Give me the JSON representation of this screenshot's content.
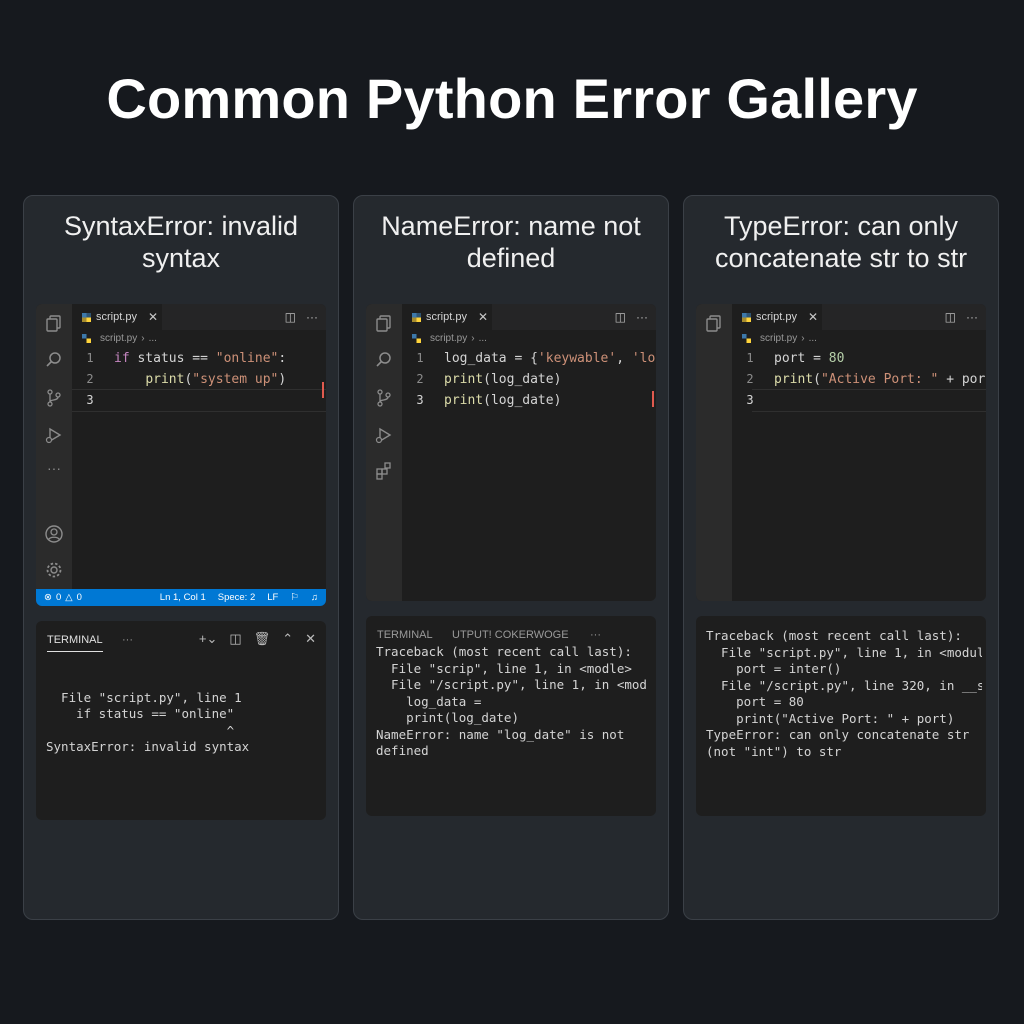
{
  "page": {
    "title": "Common Python Error Gallery"
  },
  "colors": {
    "background": "#16191e",
    "card": "#25292e",
    "editor": "#1e1e1e",
    "status_bar": "#0078d4",
    "error_marker": "#e05a4f",
    "keyword": "#c586c0",
    "string": "#ce9178",
    "function": "#dcdcaa",
    "number": "#b5cea8"
  },
  "cards": [
    {
      "heading": "SyntaxError: invalid syntax",
      "editor": {
        "tab": "script.py",
        "breadcrumb": "script.py",
        "breadcrumb_more": "...",
        "lines": [
          {
            "num": "1",
            "tokens": [
              {
                "t": "if",
                "c": "kw"
              },
              {
                "t": " status == ",
                "c": ""
              },
              {
                "t": "\"online\"",
                "c": "str"
              },
              {
                "t": ":",
                "c": ""
              }
            ]
          },
          {
            "num": "2",
            "tokens": [
              {
                "t": "    ",
                "c": ""
              },
              {
                "t": "print",
                "c": "fn"
              },
              {
                "t": "(",
                "c": ""
              },
              {
                "t": "\"system up\"",
                "c": "str"
              },
              {
                "t": ")",
                "c": ""
              }
            ]
          },
          {
            "num": "3",
            "tokens": []
          }
        ],
        "status": {
          "errors": "0",
          "warnings": "0",
          "position": "Ln 1, Col 1",
          "spaces": "Spece: 2",
          "eol": "LF"
        }
      },
      "terminal": {
        "tabs": [
          "TERMINAL",
          "···"
        ],
        "lines": [
          "",
          "  File \"script.py\", line 1",
          "    if status == \"online\"",
          "                        ^",
          "SyntaxError: invalid syntax"
        ]
      }
    },
    {
      "heading": "NameError: name not defined",
      "editor": {
        "tab": "script.py",
        "breadcrumb": "script.py",
        "breadcrumb_more": "...",
        "lines": [
          {
            "num": "1",
            "tokens": [
              {
                "t": "log_data = {",
                "c": ""
              },
              {
                "t": "'keywable'",
                "c": "str"
              },
              {
                "t": ", ",
                "c": ""
              },
              {
                "t": "'lo",
                "c": "str"
              }
            ]
          },
          {
            "num": "2",
            "tokens": [
              {
                "t": "print",
                "c": "fn"
              },
              {
                "t": "(log_date)",
                "c": ""
              }
            ]
          },
          {
            "num": "3",
            "tokens": [
              {
                "t": "print",
                "c": "fn"
              },
              {
                "t": "(log_date)",
                "c": ""
              }
            ]
          }
        ]
      },
      "terminal": {
        "tabs": [
          "TERMINAL",
          "UTPUT! COKERWOGE",
          "···"
        ],
        "lines": [
          "Traceback (most recent call last):",
          "  File \"scrip\", line 1, in <modle>",
          "  File \"/script.py\", line 1, in <mod",
          "    log_data =",
          "    print(log_date)",
          "NameError: name \"log_date\" is not",
          "defined"
        ]
      }
    },
    {
      "heading": "TypeError: can only concatenate str to str",
      "editor": {
        "tab": "script.py",
        "breadcrumb": "script.py",
        "breadcrumb_more": "...",
        "lines": [
          {
            "num": "1",
            "tokens": [
              {
                "t": "port = ",
                "c": ""
              },
              {
                "t": "80",
                "c": "num"
              }
            ]
          },
          {
            "num": "2",
            "tokens": [
              {
                "t": "print",
                "c": "fn"
              },
              {
                "t": "(",
                "c": ""
              },
              {
                "t": "\"Active Port: \"",
                "c": "str"
              },
              {
                "t": " + port)_",
                "c": ""
              }
            ]
          },
          {
            "num": "3",
            "tokens": []
          }
        ]
      },
      "terminal": {
        "tabs": [],
        "lines": [
          "Traceback (most recent call last):",
          "  File \"script.py\", line 1, in <modul",
          "    port = inter()",
          "  File \"/script.py\", line 320, in __s",
          "    port = 80",
          "    print(\"Active Port: \" + port)",
          "TypeError: can only concatenate str",
          "(not \"int\") to str"
        ]
      }
    }
  ]
}
